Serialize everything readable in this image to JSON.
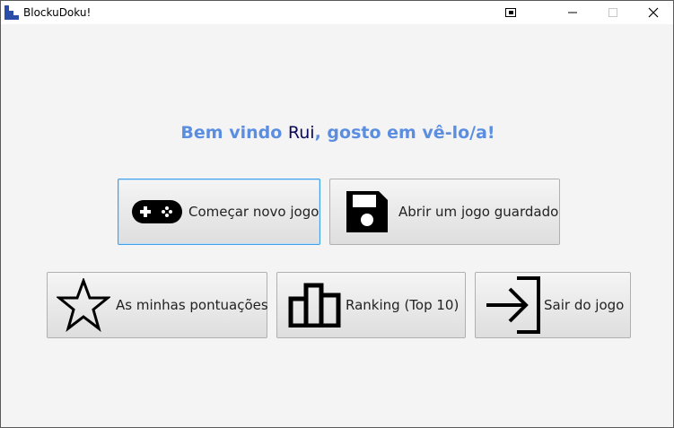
{
  "window": {
    "title": "BlockuDoku!"
  },
  "welcome": {
    "prefix": "Bem vindo ",
    "username": "Rui",
    "suffix": ", gosto em vê-lo/a!"
  },
  "menu": {
    "new_game": {
      "label": "Começar novo jogo",
      "icon": "gamepad-icon"
    },
    "open_saved": {
      "label": "Abrir um jogo guardado",
      "icon": "save-icon"
    },
    "my_scores": {
      "label": "As minhas pontuações",
      "icon": "star-icon"
    },
    "ranking": {
      "label": "Ranking (Top 10)",
      "icon": "bar-chart-icon"
    },
    "exit": {
      "label": "Sair do jogo",
      "icon": "exit-icon"
    }
  },
  "colors": {
    "accent": "#5b8de0",
    "username": "#0a0a5a",
    "focus_border": "#3ea0e8"
  }
}
